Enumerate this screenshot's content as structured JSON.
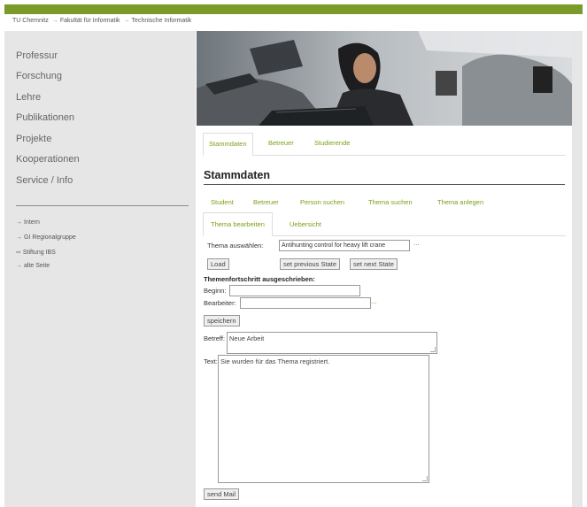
{
  "breadcrumb": {
    "items": [
      "TU Chemnitz",
      "Fakultät für Informatik",
      "Technische Informatik"
    ],
    "sep": "→"
  },
  "sidebar": {
    "items": [
      {
        "label": "Professur"
      },
      {
        "label": "Forschung"
      },
      {
        "label": "Lehre"
      },
      {
        "label": "Publikationen"
      },
      {
        "label": "Projekte"
      },
      {
        "label": "Kooperationen"
      },
      {
        "label": "Service / Info"
      }
    ],
    "sub_items": [
      {
        "arrow": "→",
        "label": "Intern"
      },
      {
        "arrow": "→",
        "label": "GI Regionalgruppe"
      },
      {
        "arrow": "⇨",
        "label": "Stiftung IBS"
      },
      {
        "arrow": "→",
        "label": "alte Seite"
      }
    ]
  },
  "tabs_main": [
    "Stammdaten",
    "Betreuer",
    "Studierende"
  ],
  "page_title": "Stammdaten",
  "tabs_sub": [
    "Student",
    "Betreuer",
    "Person suchen",
    "Thema suchen",
    "Thema anlegen",
    "Thema bearbeiten",
    "Uebersicht"
  ],
  "form": {
    "thema_label": "Thema auswählen:",
    "thema_value": "Antihunting control for heavy lift crane",
    "dots": "...",
    "load_button": "Load",
    "prev_button": "set previous State",
    "next_button": "set next State",
    "progress_heading": "Themenfortschritt ausgeschrieben:",
    "beginn_label": "Beginn:",
    "beginn_value": "",
    "bearbeiter_label": "Bearbeiter:",
    "bearbeiter_value": "",
    "speichern_button": "speichern",
    "betreff_label": "Betreff:",
    "betreff_value": "Neue Arbeit",
    "text_label": "Text:",
    "text_value": "Sie wurden für das Thema registriert.",
    "send_button": "send Mail"
  },
  "colors": {
    "accent": "#7aa01a",
    "topbar": "#7a9a2a",
    "sidebar_bg": "#e6e6e6"
  }
}
